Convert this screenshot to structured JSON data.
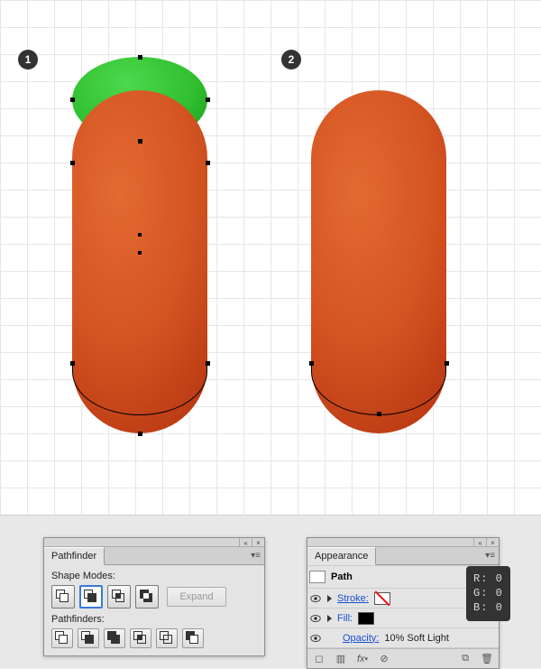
{
  "steps": {
    "one": "1",
    "two": "2"
  },
  "pathfinder": {
    "tab": "Pathfinder",
    "shape_modes_label": "Shape Modes:",
    "pathfinders_label": "Pathfinders:",
    "expand": "Expand",
    "modes": [
      "unite",
      "minus-front",
      "intersect",
      "exclude"
    ],
    "ops": [
      "divide",
      "trim",
      "merge",
      "crop",
      "outline",
      "minus-back"
    ]
  },
  "appearance": {
    "tab": "Appearance",
    "object": "Path",
    "stroke_label": "Stroke:",
    "fill_label": "Fill:",
    "opacity_label": "Opacity:",
    "opacity_value": "10% Soft Light"
  },
  "rgb": {
    "r": "R: 0",
    "g": "G: 0",
    "b": "B: 0"
  },
  "chart_data": {
    "type": "ui-illustration",
    "note": "Illustrator tutorial step: green ellipse subtracted from orange capsule via Minus Front; resulting path has black fill set to 10% Soft Light."
  }
}
